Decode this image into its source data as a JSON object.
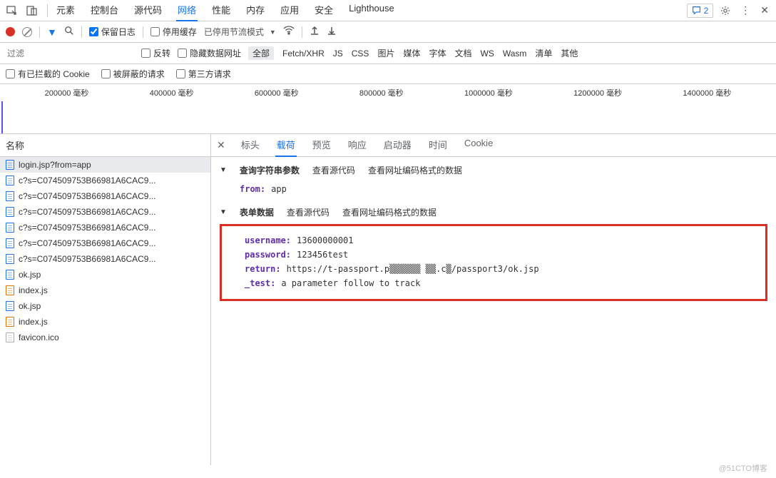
{
  "topTabs": [
    "元素",
    "控制台",
    "源代码",
    "网络",
    "性能",
    "内存",
    "应用",
    "安全",
    "Lighthouse"
  ],
  "activeTopTab": 3,
  "commentCount": "2",
  "toolbar": {
    "preserveLog": "保留日志",
    "disableCache": "停用缓存",
    "throttling": "已停用节流模式"
  },
  "filterBar": {
    "placeholder": "过滤",
    "invert": "反转",
    "hideDataUrls": "隐藏数据网址",
    "types": [
      "全部",
      "Fetch/XHR",
      "JS",
      "CSS",
      "图片",
      "媒体",
      "字体",
      "文档",
      "WS",
      "Wasm",
      "清单",
      "其他"
    ],
    "activeType": 0
  },
  "filterBar2": {
    "blockedCookies": "有已拦截的 Cookie",
    "blockedRequests": "被屏蔽的请求",
    "thirdParty": "第三方请求"
  },
  "timelineTicks": [
    "200000 毫秒",
    "400000 毫秒",
    "600000 毫秒",
    "800000 毫秒",
    "1000000 毫秒",
    "1200000 毫秒",
    "1400000 毫秒"
  ],
  "nameHeader": "名称",
  "requests": [
    {
      "name": "login.jsp?from=app",
      "icon": "blue",
      "selected": true
    },
    {
      "name": "c?s=C074509753B66981A6CAC9...",
      "icon": "blue"
    },
    {
      "name": "c?s=C074509753B66981A6CAC9...",
      "icon": "blue"
    },
    {
      "name": "c?s=C074509753B66981A6CAC9...",
      "icon": "blue"
    },
    {
      "name": "c?s=C074509753B66981A6CAC9...",
      "icon": "blue"
    },
    {
      "name": "c?s=C074509753B66981A6CAC9...",
      "icon": "blue"
    },
    {
      "name": "c?s=C074509753B66981A6CAC9...",
      "icon": "blue"
    },
    {
      "name": "ok.jsp",
      "icon": "blue"
    },
    {
      "name": "index.js",
      "icon": "orange"
    },
    {
      "name": "ok.jsp",
      "icon": "blue"
    },
    {
      "name": "index.js",
      "icon": "orange"
    },
    {
      "name": "favicon.ico",
      "icon": "gray"
    }
  ],
  "detailTabs": [
    "标头",
    "载荷",
    "预览",
    "响应",
    "启动器",
    "时间",
    "Cookie"
  ],
  "activeDetailTab": 1,
  "querySection": {
    "title": "查询字符串参数",
    "viewSource": "查看源代码",
    "viewEncoded": "查看网址编码格式的数据",
    "rows": [
      {
        "k": "from:",
        "v": "app"
      }
    ]
  },
  "formSection": {
    "title": "表单数据",
    "viewSource": "查看源代码",
    "viewEncoded": "查看网址编码格式的数据",
    "rows": [
      {
        "k": "username:",
        "v": "13600000001"
      },
      {
        "k": "password:",
        "v": "123456test"
      },
      {
        "k": "return:",
        "v": "https://t-passport.p▒▒▒▒▒▒ ▒▒.c▒/passport3/ok.jsp"
      },
      {
        "k": "_test:",
        "v": "a parameter follow to track"
      }
    ]
  },
  "watermark": "@51CTO博客"
}
